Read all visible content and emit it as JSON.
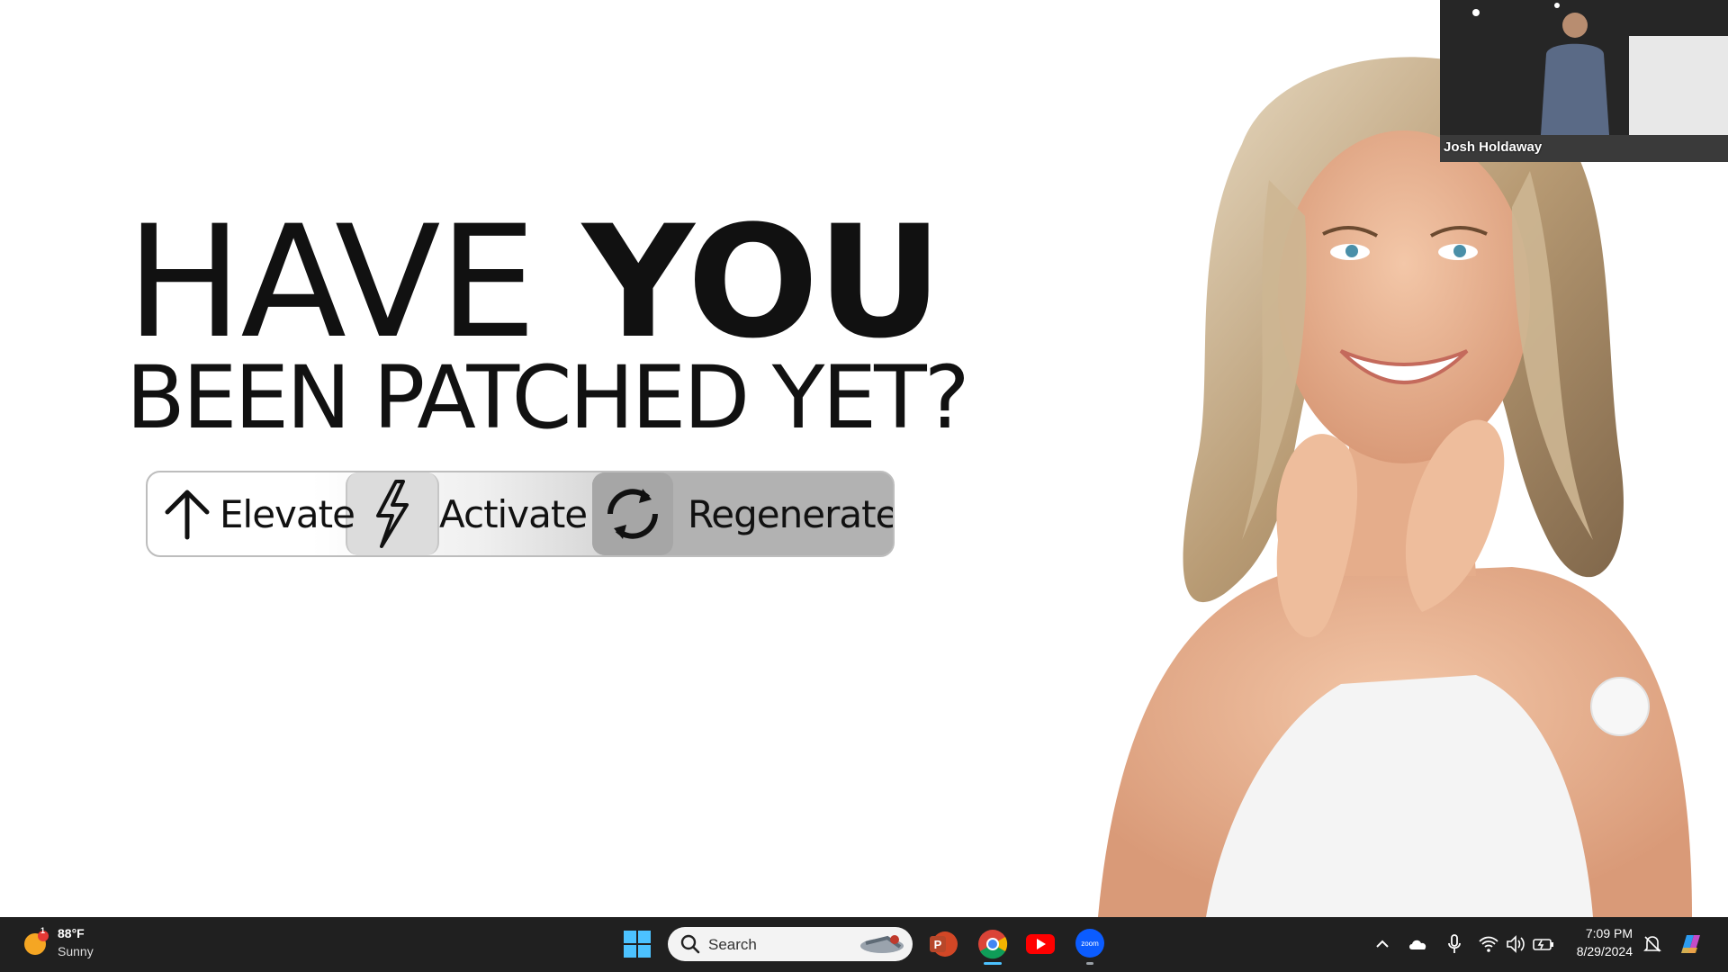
{
  "slide": {
    "headline_thin": "HAVE",
    "headline_bold": "YOU",
    "headline_line2": "BEEN PATCHED YET?",
    "pill": {
      "elevate_label": "Elevate",
      "activate_label": "Activate",
      "regenerate_label": "Regenerate"
    },
    "icons": [
      "arrow-up-icon",
      "lightning-bolt-icon",
      "refresh-cycle-icon"
    ]
  },
  "video_tile": {
    "participant_name": "Josh Holdaway"
  },
  "taskbar": {
    "weather": {
      "temperature": "88°F",
      "condition": "Sunny",
      "alert_count": "1"
    },
    "search_placeholder": "Search",
    "apps": [
      "windows-start-icon",
      "powerpoint-icon",
      "chrome-icon",
      "youtube-icon",
      "zoom-icon"
    ],
    "tray_icons": [
      "chevron-up-icon",
      "onedrive-cloud-icon",
      "microphone-icon",
      "wifi-icon",
      "volume-icon",
      "battery-icon",
      "notification-icon",
      "copilot-icon"
    ],
    "clock": {
      "time": "7:09 PM",
      "date": "8/29/2024"
    }
  },
  "colors": {
    "taskbar_bg": "#202020",
    "accent_blue": "#4cc2ff",
    "youtube_red": "#ff0000",
    "powerpoint_orange": "#d24726",
    "zoom_blue": "#0b5cff"
  }
}
